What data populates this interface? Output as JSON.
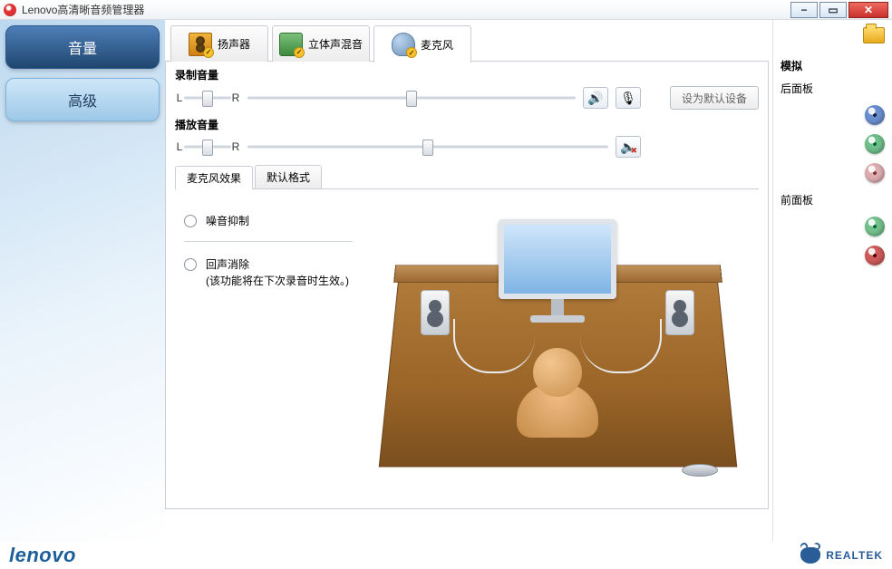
{
  "window": {
    "title": "Lenovo高清晰音频管理器"
  },
  "leftnav": {
    "volume": "音量",
    "advanced": "高级"
  },
  "toptabs": {
    "speaker": "扬声器",
    "stereomix": "立体声混音",
    "microphone": "麦克风"
  },
  "sliders": {
    "record_title": "录制音量",
    "playback_title": "播放音量",
    "L": "L",
    "R": "R"
  },
  "buttons": {
    "set_default": "设为默认设备"
  },
  "subtabs": {
    "effects": "麦克风效果",
    "default_format": "默认格式"
  },
  "effects": {
    "noise_suppress": "噪音抑制",
    "echo_cancel_line1": "回声消除",
    "echo_cancel_line2": "(该功能将在下次录音时生效。)"
  },
  "rightpanel": {
    "title": "模拟",
    "back_panel": "后面板",
    "front_panel": "前面板"
  },
  "footer": {
    "lenovo": "lenovo",
    "realtek": "REALTEK"
  }
}
